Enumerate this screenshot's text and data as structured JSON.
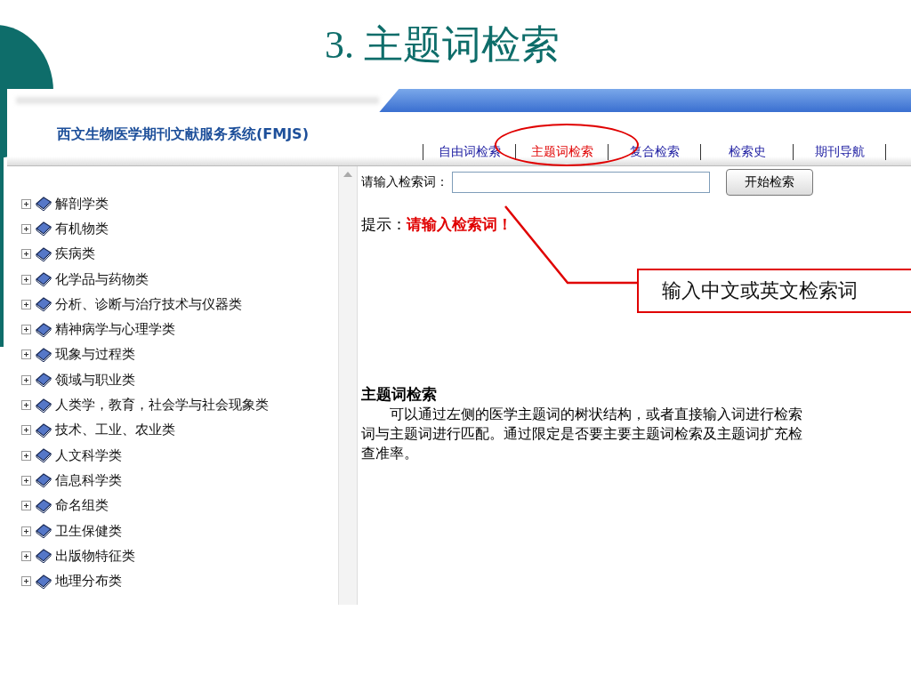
{
  "slide": {
    "title": "3. 主题词检索",
    "callout": "输入中文或英文检索词"
  },
  "site": {
    "title": "西文生物医学期刊文献服务系统(FMJS)",
    "nav": [
      {
        "label": "自由词检索",
        "selected": false
      },
      {
        "label": "主题词检索",
        "selected": true
      },
      {
        "label": "复合检索",
        "selected": false
      },
      {
        "label": "检索史",
        "selected": false
      },
      {
        "label": "期刊导航",
        "selected": false
      }
    ]
  },
  "tree": [
    {
      "label": "解剖学类",
      "expanded": false
    },
    {
      "label": "有机物类",
      "expanded": false
    },
    {
      "label": "疾病类",
      "expanded": false
    },
    {
      "label": "化学品与药物类",
      "expanded": false
    },
    {
      "label": "分析、诊断与治疗技术与仪器类",
      "expanded": false
    },
    {
      "label": "精神病学与心理学类",
      "expanded": false
    },
    {
      "label": "现象与过程类",
      "expanded": false
    },
    {
      "label": "领域与职业类",
      "expanded": false
    },
    {
      "label": "人类学，教育，社会学与社会现象类",
      "expanded": false
    },
    {
      "label": "技术、工业、农业类",
      "expanded": false
    },
    {
      "label": "人文科学类",
      "expanded": false
    },
    {
      "label": "信息科学类",
      "expanded": false
    },
    {
      "label": "命名组类",
      "expanded": false
    },
    {
      "label": "卫生保健类",
      "expanded": false
    },
    {
      "label": "出版物特征类",
      "expanded": false
    },
    {
      "label": "地理分布类",
      "expanded": false
    }
  ],
  "search": {
    "label": "请输入检索词：",
    "button": "开始检索"
  },
  "hint": {
    "label": "提示：",
    "message": "请输入检索词！"
  },
  "help": {
    "heading": "主题词检索",
    "lines": [
      "　　可以通过左侧的医学主题词的树状结构，或者直接输入词进行检索",
      "词与主题词进行匹配。通过限定是否要主要主题词检索及主题词扩充检",
      "查准率。"
    ]
  }
}
